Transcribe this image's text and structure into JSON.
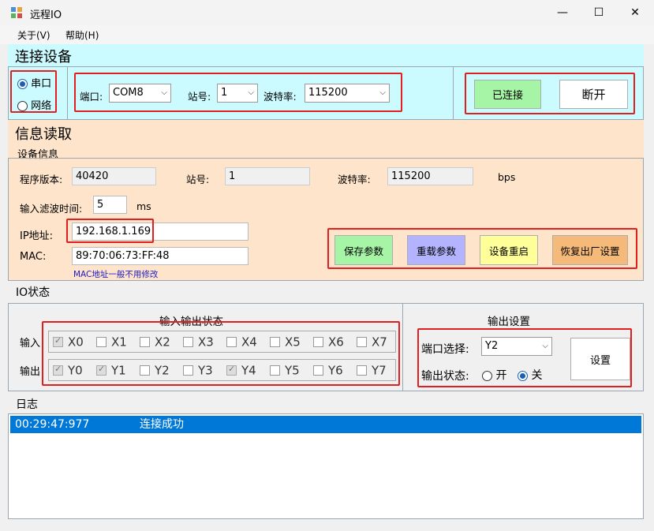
{
  "window": {
    "title": "远程IO"
  },
  "menu": [
    {
      "label": "关于(V)"
    },
    {
      "label": "帮助(H)"
    }
  ],
  "connect": {
    "title": "连接设备",
    "serial_label": "串口",
    "network_label": "网络",
    "port_label": "端口:",
    "port_value": "COM8",
    "station_label": "站号:",
    "station_value": "1",
    "baud_label": "波特率:",
    "baud_value": "115200",
    "connected_label": "已连接",
    "disconnect_label": "断开"
  },
  "info": {
    "title": "信息读取",
    "device_info_label": "设备信息",
    "fw_label": "程序版本:",
    "fw_value": "40420",
    "station_label": "站号:",
    "station_value": "1",
    "baud_label": "波特率:",
    "baud_value": "115200",
    "baud_unit": "bps",
    "filter_label": "输入滤波时间:",
    "filter_value": "5",
    "filter_unit": "ms",
    "ip_label": "IP地址:",
    "ip_value": "192.168.1.169",
    "mac_label": "MAC:",
    "mac_value": "89:70:06:73:FF:48",
    "mac_hint": "MAC地址一般不用修改",
    "save_label": "保存参数",
    "reload_label": "重载参数",
    "restart_label": "设备重启",
    "factory_label": "恢复出厂设置"
  },
  "io": {
    "title": "IO状态",
    "group_title": "输入输出状态",
    "input_label": "输入",
    "output_label": "输出",
    "inputs": [
      {
        "name": "X0",
        "checked": true
      },
      {
        "name": "X1",
        "checked": false
      },
      {
        "name": "X2",
        "checked": false
      },
      {
        "name": "X3",
        "checked": false
      },
      {
        "name": "X4",
        "checked": false
      },
      {
        "name": "X5",
        "checked": false
      },
      {
        "name": "X6",
        "checked": false
      },
      {
        "name": "X7",
        "checked": false
      }
    ],
    "outputs": [
      {
        "name": "Y0",
        "checked": true
      },
      {
        "name": "Y1",
        "checked": true
      },
      {
        "name": "Y2",
        "checked": false
      },
      {
        "name": "Y3",
        "checked": false
      },
      {
        "name": "Y4",
        "checked": true
      },
      {
        "name": "Y5",
        "checked": false
      },
      {
        "name": "Y6",
        "checked": false
      },
      {
        "name": "Y7",
        "checked": false
      }
    ],
    "output_settings_title": "输出设置",
    "port_select_label": "端口选择:",
    "port_select_value": "Y2",
    "output_state_label": "输出状态:",
    "on_label": "开",
    "off_label": "关",
    "set_label": "设置"
  },
  "log": {
    "title": "日志",
    "entries": [
      {
        "time": "00:29:47:977",
        "message": "连接成功"
      }
    ]
  },
  "colors": {
    "cyan": "#cbfaff",
    "peach": "#fde4cb",
    "green_btn": "#a6f5a6",
    "purple_btn": "#b3b3ff",
    "yellow_btn": "#ffff99",
    "orange_btn": "#f5b97a",
    "log_select": "#0078d7"
  }
}
